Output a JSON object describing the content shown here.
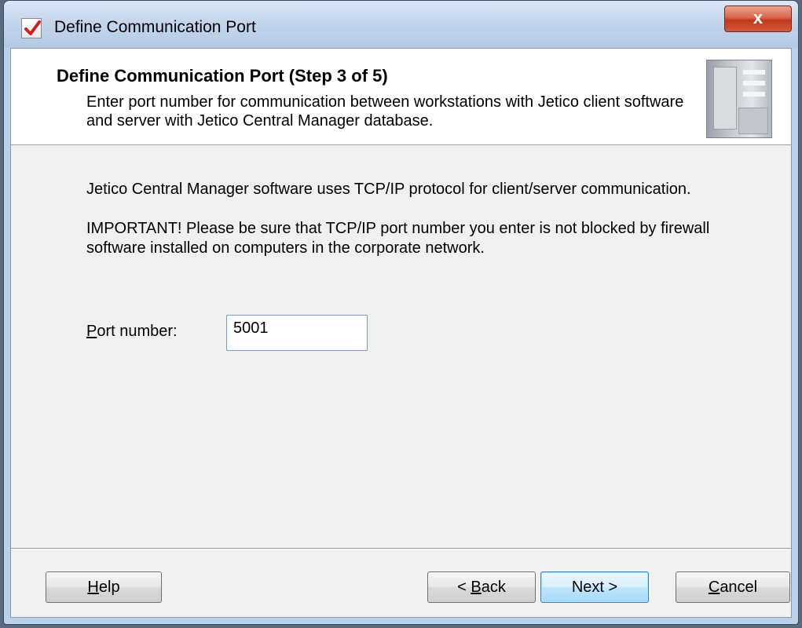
{
  "window": {
    "title": "Define Communication Port",
    "close_label": "x"
  },
  "header": {
    "title": "Define Communication Port (Step 3 of 5)",
    "description": "Enter port number for communication between workstations with Jetico client software and server with Jetico Central Manager database."
  },
  "body": {
    "paragraph1": "Jetico Central Manager software uses TCP/IP protocol for client/server communication.",
    "paragraph2": "IMPORTANT! Please be sure that TCP/IP port number you enter is not blocked by firewall software installed on computers in the corporate network."
  },
  "port": {
    "label_accel": "P",
    "label_rest": "ort number:",
    "value": "5001"
  },
  "buttons": {
    "help_accel": "H",
    "help_rest": "elp",
    "back_prefix": "< ",
    "back_accel": "B",
    "back_rest": "ack",
    "next_label": "Next >",
    "cancel_accel": "C",
    "cancel_rest": "ancel"
  },
  "colors": {
    "accent": "#3c7fb1",
    "close": "#c2381c"
  }
}
